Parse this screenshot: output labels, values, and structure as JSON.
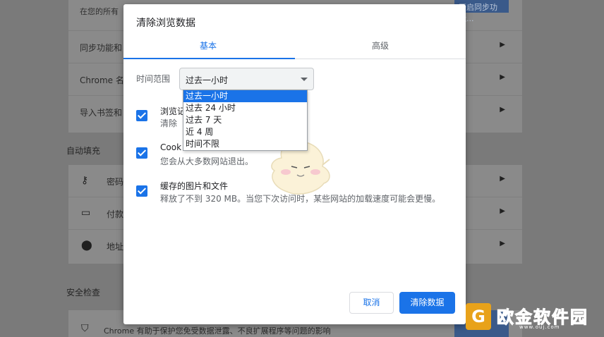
{
  "background": {
    "top_text": "在您的所有",
    "top_button": "开启同步功能...",
    "rows_card1": [
      "同步功能和",
      "Chrome 名",
      "导入书签和"
    ],
    "section_autofill": "自动填充",
    "rows_card2": [
      {
        "icon": "key-icon",
        "label": "密码"
      },
      {
        "icon": "credit-card-icon",
        "label": "付款"
      },
      {
        "icon": "location-pin-icon",
        "label": "地址"
      }
    ],
    "section_safety": "安全检查",
    "safety_text": "Chrome 有助于保护您免受数据泄露、不良扩展程序等问题的影响"
  },
  "dialog": {
    "title": "清除浏览数据",
    "tabs": [
      {
        "label": "基本",
        "active": true
      },
      {
        "label": "高级",
        "active": false
      }
    ],
    "time_range_label": "时间范围",
    "time_range_value": "过去一小时",
    "dropdown_options": [
      "过去一小时",
      "过去 24 小时",
      "过去 7 天",
      "近 4 周",
      "时间不限"
    ],
    "dropdown_selected_index": 0,
    "options": [
      {
        "title": "浏览记",
        "desc": "清除",
        "checked": true
      },
      {
        "title": "Cook",
        "desc": "您会从大多数网站退出。",
        "checked": true
      },
      {
        "title": "缓存的图片和文件",
        "desc": "释放了不到 320 MB。当您下次访问时，某些网站的加载速度可能会更慢。",
        "checked": true
      }
    ],
    "cancel_label": "取消",
    "clear_label": "清除数据"
  },
  "watermark": {
    "text": "欧金软件园",
    "url": "www.ouj.com"
  },
  "colors": {
    "accent": "#1a73e8",
    "watermark": "#f0a21a"
  }
}
